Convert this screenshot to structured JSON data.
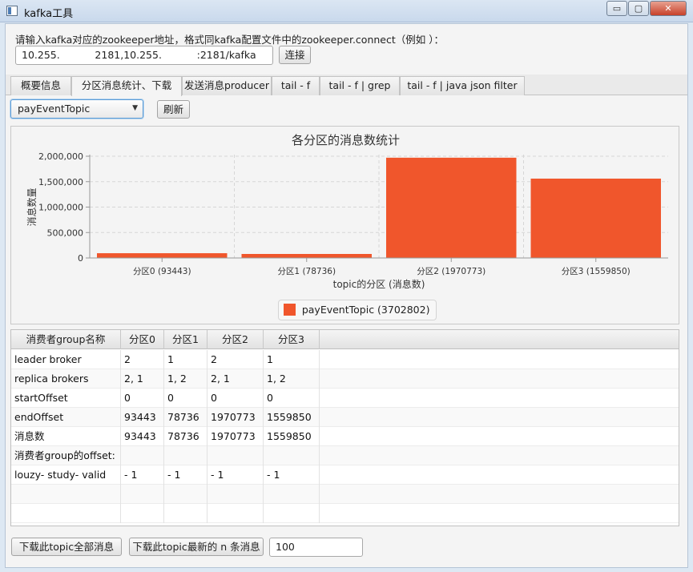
{
  "window": {
    "title": "kafka工具",
    "minimize": "▭",
    "maximize": "▢",
    "close": "✕"
  },
  "connection": {
    "prompt": "请输入kafka对应的zookeeper地址，格式同kafka配置文件中的zookeeper.connect（例如 ）：",
    "address": "10.255.           2181,10.255.           :2181/kafka",
    "connect_label": "连接"
  },
  "tabs": [
    {
      "label": "概要信息"
    },
    {
      "label": "分区消息统计、下载"
    },
    {
      "label": "发送消息producer"
    },
    {
      "label": "tail - f"
    },
    {
      "label": "tail - f | grep"
    },
    {
      "label": "tail - f | java json filter"
    }
  ],
  "topic": {
    "selected": "payEventTopic",
    "refresh_label": "刷新"
  },
  "chart_data": {
    "type": "bar",
    "title": "各分区的消息数统计",
    "xlabel": "topic的分区 (消息数)",
    "ylabel": "消息数量",
    "categories": [
      "分区0 (93443)",
      "分区1 (78736)",
      "分区2 (1970773)",
      "分区3 (1559850)"
    ],
    "series": [
      {
        "name": "payEventTopic (3702802)",
        "values": [
          93443,
          78736,
          1970773,
          1559850
        ]
      }
    ],
    "ylim": [
      0,
      2000000
    ],
    "yticks": [
      "0",
      "500,000",
      "1,000,000",
      "1,500,000",
      "2,000,000"
    ],
    "color": "#f0562c",
    "grid": true,
    "legend": "bottom-center"
  },
  "table": {
    "headers": [
      "消费者group名称",
      "分区0",
      "分区1",
      "分区2",
      "分区3"
    ],
    "rows": [
      [
        "leader broker",
        "2",
        "1",
        "2",
        "1"
      ],
      [
        "replica brokers",
        "2, 1",
        "1, 2",
        "2, 1",
        "1, 2"
      ],
      [
        "startOffset",
        "0",
        "0",
        "0",
        "0"
      ],
      [
        "endOffset",
        "93443",
        "78736",
        "1970773",
        "1559850"
      ],
      [
        "消息数",
        "93443",
        "78736",
        "1970773",
        "1559850"
      ],
      [
        "消费者group的offset:",
        "",
        "",
        "",
        ""
      ],
      [
        "louzy- study- valid",
        "- 1",
        "- 1",
        "- 1",
        "- 1"
      ],
      [
        "",
        "",
        "",
        "",
        ""
      ],
      [
        "",
        "",
        "",
        "",
        ""
      ]
    ]
  },
  "download": {
    "all_label": "下载此topic全部消息",
    "latest_label": "下载此topic最新的 n 条消息",
    "count": "100"
  }
}
